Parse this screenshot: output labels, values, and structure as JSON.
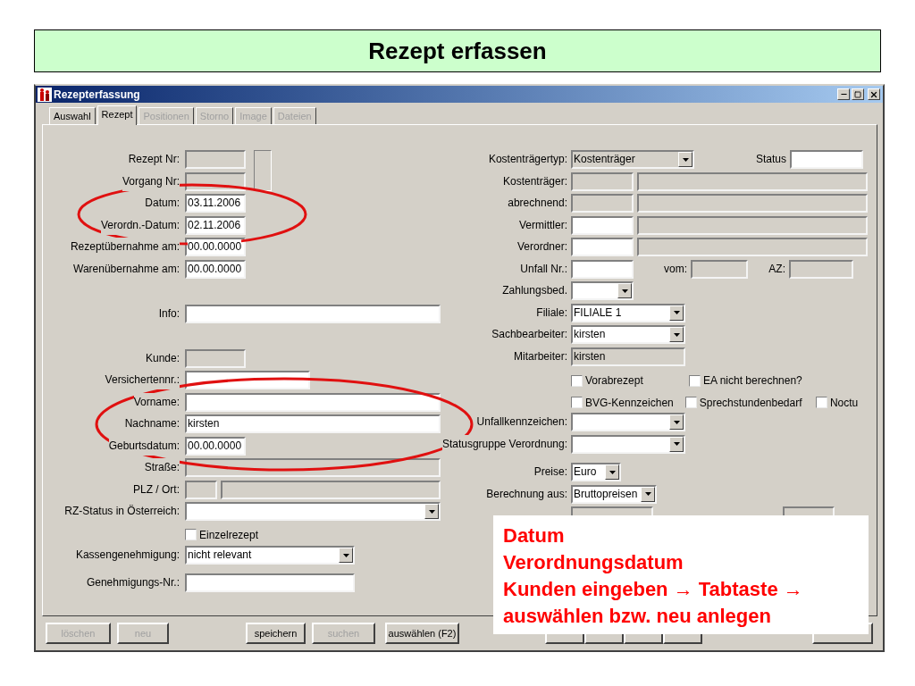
{
  "slide_title": "Rezept erfassen",
  "window": {
    "title": "Rezepterfassung"
  },
  "tabs": [
    {
      "label": "Auswahl",
      "selected": false,
      "disabled": false
    },
    {
      "label": "Rezept",
      "selected": true,
      "disabled": false
    },
    {
      "label": "Positionen",
      "selected": false,
      "disabled": true
    },
    {
      "label": "Storno",
      "selected": false,
      "disabled": true
    },
    {
      "label": "Image",
      "selected": false,
      "disabled": true
    },
    {
      "label": "Dateien",
      "selected": false,
      "disabled": true
    }
  ],
  "left": [
    {
      "kind": "field",
      "label": "Rezept Nr:",
      "fields": [
        {
          "editable": false
        }
      ]
    },
    {
      "kind": "field",
      "label": "Vorgang Nr:",
      "fields": [
        {
          "editable": false
        }
      ]
    },
    {
      "kind": "field",
      "label": "Datum:",
      "fields": [
        {
          "value": "03.11.2006",
          "editable": true
        }
      ]
    },
    {
      "kind": "field",
      "label": "Verordn.-Datum:",
      "fields": [
        {
          "value": "02.11.2006",
          "editable": true
        }
      ]
    },
    {
      "kind": "field",
      "label": "Rezeptübernahme am:",
      "fields": [
        {
          "value": "00.00.0000",
          "editable": true
        }
      ]
    },
    {
      "kind": "field",
      "label": "Warenübernahme am:",
      "fields": [
        {
          "value": "00.00.0000",
          "editable": true
        }
      ]
    },
    {
      "kind": "field",
      "label": "Info:",
      "fields": [
        {
          "editable": true
        }
      ]
    },
    {
      "kind": "field",
      "label": "Kunde:",
      "fields": [
        {
          "editable": false
        }
      ]
    },
    {
      "kind": "field",
      "label": "Versichertennr.:",
      "fields": [
        {
          "editable": true
        }
      ]
    },
    {
      "kind": "field",
      "label": "Vorname:",
      "fields": [
        {
          "editable": true
        }
      ]
    },
    {
      "kind": "field",
      "label": "Nachname:",
      "fields": [
        {
          "value": "kirsten",
          "editable": true
        }
      ]
    },
    {
      "kind": "field",
      "label": "Geburtsdatum:",
      "fields": [
        {
          "value": "00.00.0000",
          "editable": true
        }
      ]
    },
    {
      "kind": "field",
      "label": "Straße:",
      "fields": [
        {
          "editable": false
        }
      ]
    },
    {
      "kind": "field",
      "label": "PLZ / Ort:",
      "fields": [
        {
          "editable": false
        },
        {
          "editable": false
        }
      ]
    },
    {
      "kind": "field",
      "label": "RZ-Status in Österreich:",
      "fields": [
        {
          "editable": true,
          "kind": "combo"
        }
      ]
    },
    {
      "kind": "checkbox",
      "label": "Einzelrezept",
      "checked": false
    },
    {
      "kind": "field",
      "label": "Kassengenehmigung:",
      "fields": [
        {
          "value": "nicht relevant",
          "editable": true,
          "kind": "combo"
        }
      ]
    },
    {
      "kind": "field",
      "label": "Genehmigungs-Nr.:",
      "fields": [
        {
          "editable": true
        }
      ]
    }
  ],
  "right": [
    {
      "kind": "field",
      "label": "Kostenträgertyp:",
      "fields": [
        {
          "value": "Kostenträger",
          "editable": false,
          "kind": "combo"
        },
        {
          "label": "Status",
          "editable": true
        }
      ]
    },
    {
      "kind": "field",
      "label": "Kostenträger:",
      "fields": [
        {
          "editable": false
        },
        {
          "editable": false
        }
      ]
    },
    {
      "kind": "field",
      "label": "abrechnend:",
      "fields": [
        {
          "editable": false
        },
        {
          "editable": false
        }
      ]
    },
    {
      "kind": "field",
      "label": "Vermittler:",
      "fields": [
        {
          "editable": true
        },
        {
          "editable": false
        }
      ]
    },
    {
      "kind": "field",
      "label": "Verordner:",
      "fields": [
        {
          "editable": true
        },
        {
          "editable": false
        }
      ]
    },
    {
      "kind": "field",
      "label": "Unfall Nr.:",
      "fields": [
        {
          "editable": true
        },
        {
          "label": "vom:",
          "editable": false
        },
        {
          "label": "AZ:",
          "editable": false
        }
      ]
    },
    {
      "kind": "field",
      "label": "Zahlungsbed.",
      "fields": [
        {
          "editable": true,
          "kind": "combo"
        }
      ]
    },
    {
      "kind": "field",
      "label": "Filiale:",
      "fields": [
        {
          "value": "FILIALE 1",
          "editable": true,
          "kind": "combo"
        }
      ]
    },
    {
      "kind": "field",
      "label": "Sachbearbeiter:",
      "fields": [
        {
          "value": "kirsten",
          "editable": true,
          "kind": "combo"
        }
      ]
    },
    {
      "kind": "field",
      "label": "Mitarbeiter:",
      "fields": [
        {
          "value": "kirsten",
          "editable": false
        }
      ]
    },
    {
      "kind": "checkboxes",
      "items": [
        {
          "label": "Vorabrezept",
          "checked": false
        },
        {
          "label": "EA nicht berechnen?",
          "checked": false
        }
      ]
    },
    {
      "kind": "checkboxes",
      "items": [
        {
          "label": "BVG-Kennzeichen",
          "checked": false
        },
        {
          "label": "Sprechstundenbedarf",
          "checked": false
        },
        {
          "label": "Noctu",
          "checked": false
        }
      ]
    },
    {
      "kind": "field",
      "label": "Unfallkennzeichen:",
      "fields": [
        {
          "editable": true,
          "kind": "combo"
        }
      ]
    },
    {
      "kind": "field",
      "label": "Statusgruppe Verordnung:",
      "fields": [
        {
          "editable": true,
          "kind": "combo"
        }
      ]
    },
    {
      "kind": "field",
      "label": "Preise:",
      "fields": [
        {
          "value": "Euro",
          "editable": true,
          "kind": "combo"
        }
      ]
    },
    {
      "kind": "field",
      "label": "Berechnung aus:",
      "fields": [
        {
          "value": "Bruttopreisen",
          "editable": true,
          "kind": "combo"
        }
      ]
    },
    {
      "kind": "field",
      "fields": [
        {
          "editable": false
        },
        {
          "editable": false
        }
      ]
    }
  ],
  "buttons": [
    {
      "label": "löschen",
      "disabled": true
    },
    {
      "label": "neu",
      "disabled": true
    },
    {
      "label": "speichern",
      "disabled": false
    },
    {
      "label": "suchen",
      "disabled": true
    },
    {
      "label": "auswählen (F2)",
      "disabled": false
    }
  ],
  "annotation": [
    "Datum",
    "Verordnungsdatum",
    "Kunden eingeben → Tabtaste →",
    "auswählen bzw. neu anlegen"
  ]
}
